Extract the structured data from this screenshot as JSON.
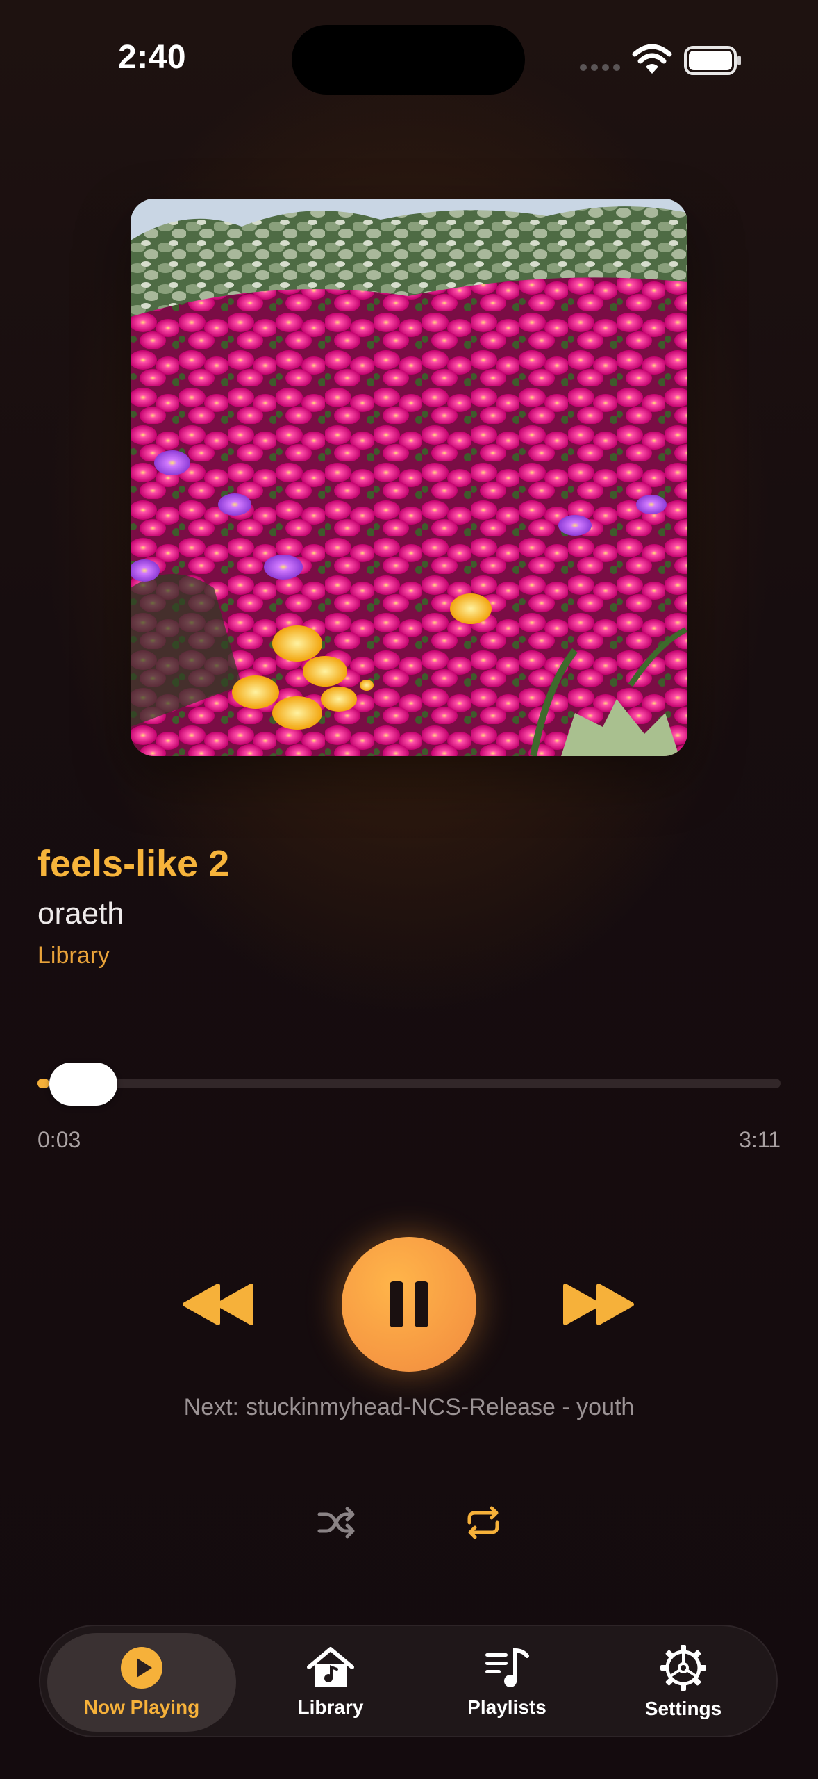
{
  "status_bar": {
    "time": "2:40",
    "icons": [
      "cellular-dots-icon",
      "wifi-icon",
      "battery-icon"
    ]
  },
  "now_playing": {
    "artwork": "flower-field-artwork",
    "title": "feels-like 2",
    "artist": "oraeth",
    "source": "Library",
    "elapsed": "0:03",
    "duration": "3:11",
    "progress_fraction": 0.016,
    "next_prefix": "Next:",
    "next_track": "stuckinmyhead-NCS-Release - youth"
  },
  "controls": {
    "rewind_icon": "rewind-icon",
    "pause_icon": "pause-icon",
    "forward_icon": "fast-forward-icon",
    "shuffle_icon": "shuffle-icon",
    "repeat_icon": "repeat-icon",
    "repeat_active": true,
    "shuffle_active": false
  },
  "tabs": [
    {
      "label": "Now Playing",
      "icon": "play-circle-icon",
      "active": true
    },
    {
      "label": "Library",
      "icon": "home-music-icon",
      "active": false
    },
    {
      "label": "Playlists",
      "icon": "playlist-icon",
      "active": false
    },
    {
      "label": "Settings",
      "icon": "gear-icon",
      "active": false
    }
  ],
  "colors": {
    "accent": "#f6b13a",
    "background": "#140b0d",
    "play_button": "#f79b43"
  }
}
